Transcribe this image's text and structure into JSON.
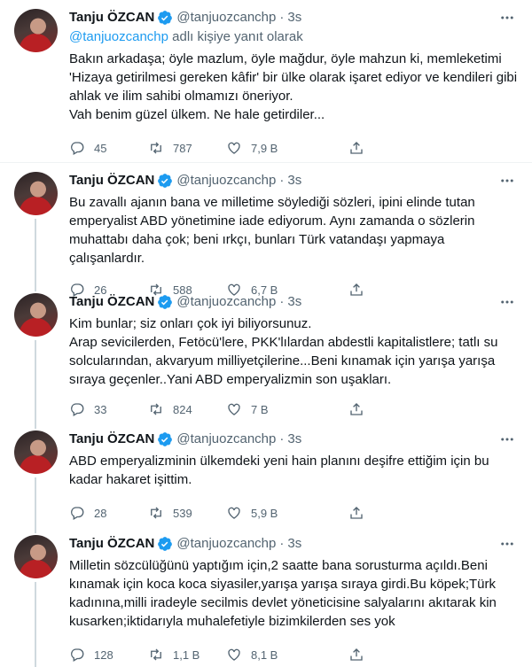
{
  "tweets": [
    {
      "name": "Tanju ÖZCAN",
      "handle": "@tanjuozcanchp",
      "time": "3s",
      "replying_prefix": "@tanjuozcanchp",
      "replying_suffix": " adlı kişiye yanıt olarak",
      "text": "Bakın arkadaşa; öyle mazlum, öyle mağdur, öyle mahzun ki, memleketimi\n'Hizaya getirilmesi gereken kâfir' bir ülke olarak işaret ediyor ve kendileri gibi\nahlak ve ilim sahibi olmamızı öneriyor.\nVah benim güzel ülkem. Ne hale getirdiler...",
      "replies": "45",
      "retweets": "787",
      "likes": "7,9 B"
    },
    {
      "name": "Tanju ÖZCAN",
      "handle": "@tanjuozcanchp",
      "time": "3s",
      "text": "Bu zavallı ajanın bana ve milletime söylediği sözleri, ipini elinde tutan\nemperyalist ABD yönetimine iade ediyorum. Aynı zamanda o sözlerin\nmuhattabı daha çok; beni ırkçı, bunları  Türk vatandaşı yapmaya çalışanlardır.",
      "replies": "26",
      "retweets": "588",
      "likes": "6,7 B"
    },
    {
      "name": "Tanju ÖZCAN",
      "handle": "@tanjuozcanchp",
      "time": "3s",
      "text": "Kim bunlar; siz onları çok iyi biliyorsunuz.\nArap sevicilerden, Fetöcü'lere, PKK'lılardan abdestli kapitalistlere; tatlı su\nsolcularından, akvaryum milliyetçilerine...Beni kınamak için yarışa yarışa\nsıraya geçenler..Yani ABD emperyalizmin son uşakları.",
      "replies": "33",
      "retweets": "824",
      "likes": "7 B"
    },
    {
      "name": "Tanju ÖZCAN",
      "handle": "@tanjuozcanchp",
      "time": "3s",
      "text": "ABD emperyalizminin ülkemdeki yeni hain planını deşifre ettiğim için bu\nkadar hakaret işittim.",
      "replies": "28",
      "retweets": "539",
      "likes": "5,9 B"
    },
    {
      "name": "Tanju ÖZCAN",
      "handle": "@tanjuozcanchp",
      "time": "3s",
      "text": "Milletin sözcülüğünü yaptığım için,2 saatte bana sorusturma açıldı.Beni\nkınamak için koca koca siyasiler,yarışa yarışa sıraya girdi.Bu köpek;Türk\nkadınına,milli iradeyle secilmis devlet yöneticisine salyalarını akıtarak kin\nkusarken;iktidarıyla muhalefetiyle bizimkilerden ses yok",
      "replies": "128",
      "retweets": "1,1 B",
      "likes": "8,1 B"
    }
  ],
  "colors": {
    "accent": "#1d9bf0",
    "muted": "#536471",
    "text": "#0f1419",
    "border": "#eff3f4"
  },
  "icons": [
    "verified-badge-icon",
    "more-icon",
    "reply-icon",
    "retweet-icon",
    "like-icon",
    "share-icon"
  ]
}
